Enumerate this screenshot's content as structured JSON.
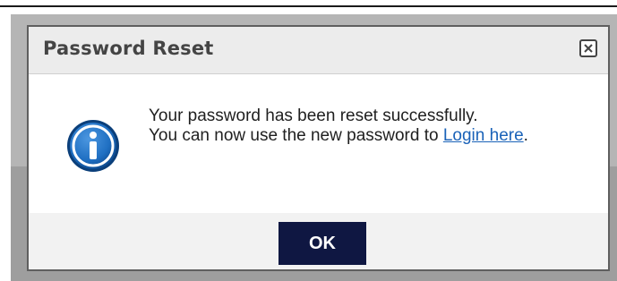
{
  "dialog": {
    "title": "Password Reset",
    "close_icon": "close-icon",
    "info_icon": "info-icon",
    "message_line1": "Your password has been reset successfully.",
    "message_line2_prefix": "You can now use the new password to ",
    "login_link_text": "Login here",
    "message_suffix": ".",
    "ok_label": "OK"
  },
  "colors": {
    "ok_button_bg": "#0f1742",
    "link": "#1a62b8",
    "title_text": "#444444",
    "info_icon_blue": "#1f6fc2"
  }
}
